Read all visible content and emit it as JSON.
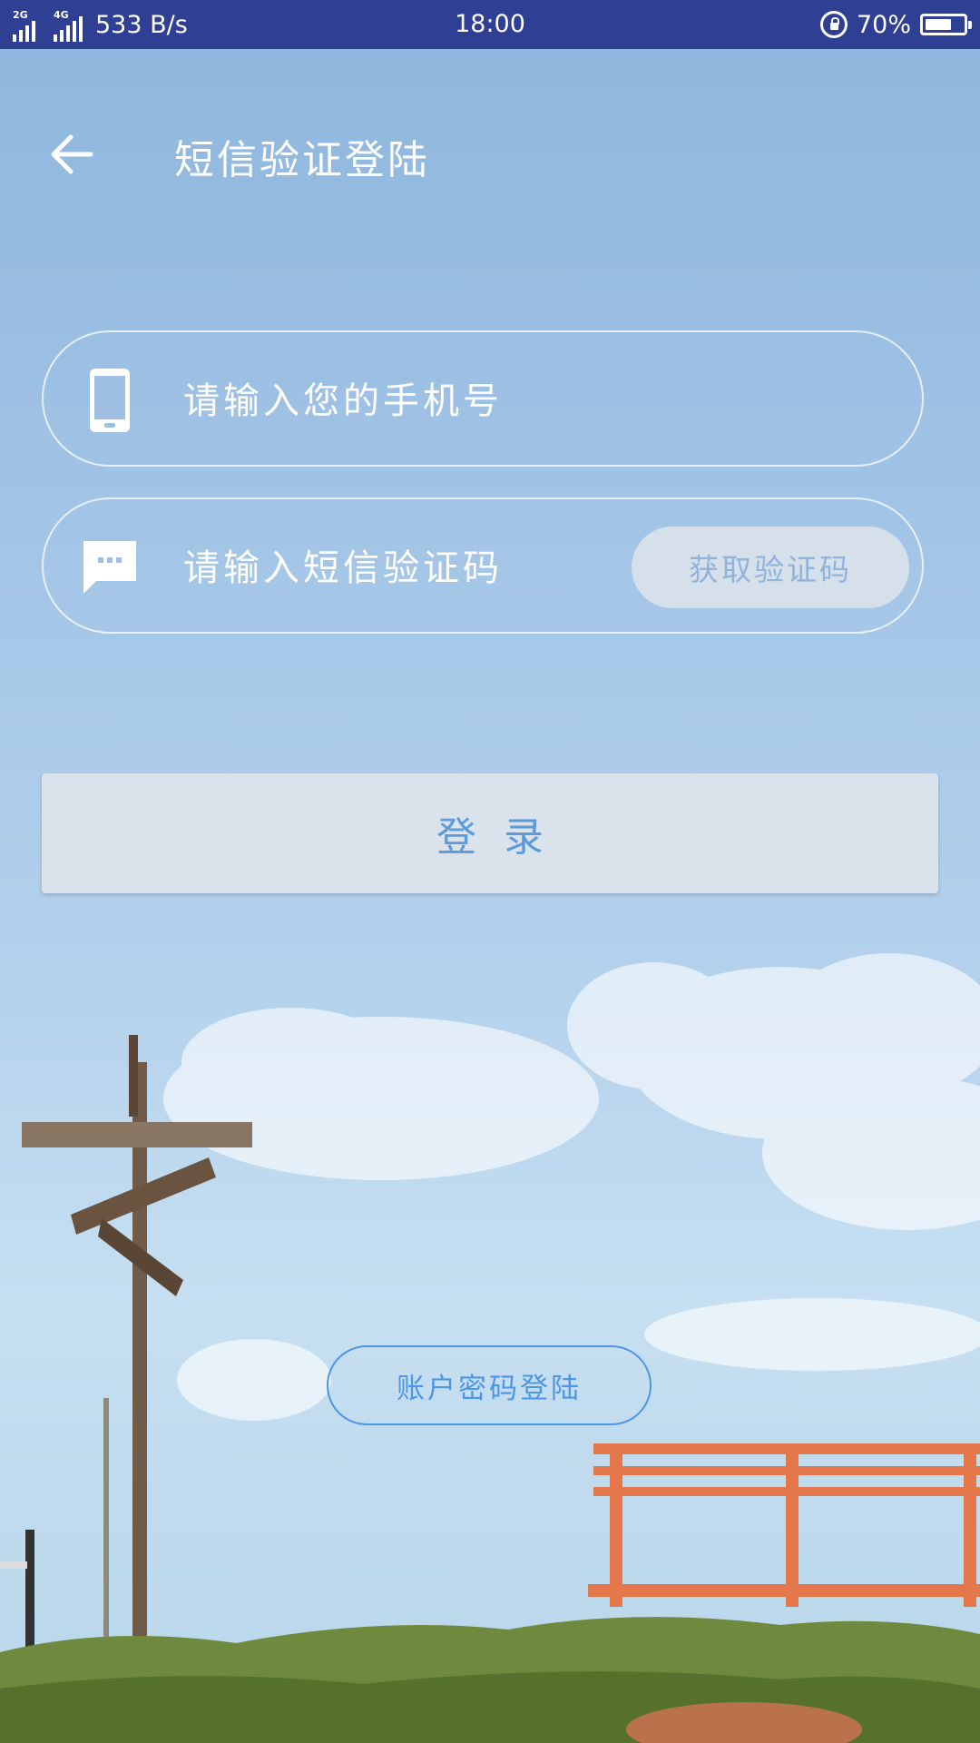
{
  "status_bar": {
    "signal1_tag": "2G",
    "signal2_tag": "4G",
    "net_speed": "533 B/s",
    "time": "18:00",
    "battery_percent": "70%",
    "battery_level": 0.7,
    "icons": [
      "signal-2g-icon",
      "signal-4g-icon",
      "rotation-lock-icon",
      "battery-icon"
    ]
  },
  "header": {
    "back_icon": "arrow-left-icon",
    "title": "短信验证登陆"
  },
  "form": {
    "phone_icon": "mobile-phone-icon",
    "phone_placeholder": "请输入您的手机号",
    "sms_icon": "message-bubble-icon",
    "sms_placeholder": "请输入短信验证码",
    "get_code_label": "获取验证码",
    "login_label": "登录"
  },
  "footer": {
    "account_login_label": "账户密码登陆"
  },
  "colors": {
    "status_bar": "#2f3f93",
    "accent_blue": "#4d95e6",
    "login_text": "#5b9bd9",
    "button_bg": "#dce3ec"
  }
}
